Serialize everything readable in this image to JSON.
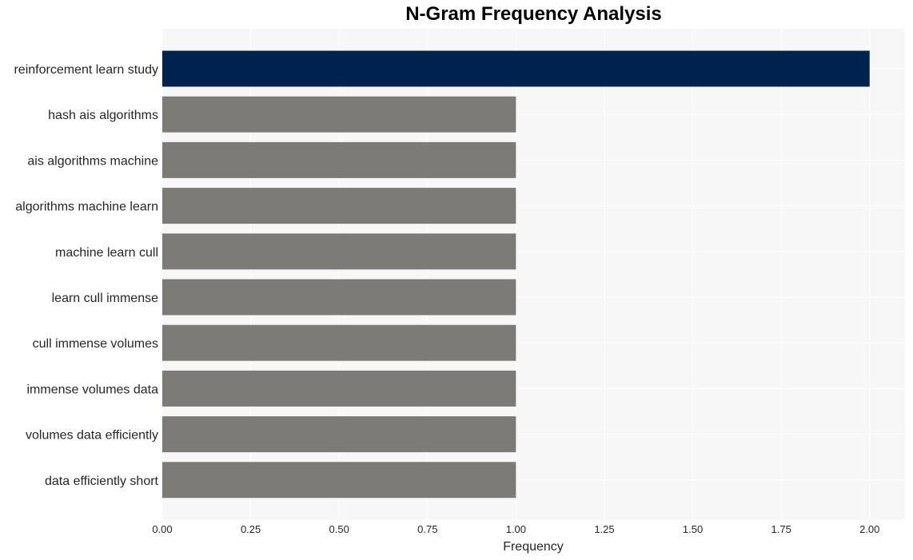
{
  "chart_data": {
    "type": "bar",
    "orientation": "horizontal",
    "title": "N-Gram Frequency Analysis",
    "xlabel": "Frequency",
    "ylabel": "",
    "categories": [
      "reinforcement learn study",
      "hash ais algorithms",
      "ais algorithms machine",
      "algorithms machine learn",
      "machine learn cull",
      "learn cull immense",
      "cull immense volumes",
      "immense volumes data",
      "volumes data efficiently",
      "data efficiently short"
    ],
    "values": [
      2,
      1,
      1,
      1,
      1,
      1,
      1,
      1,
      1,
      1
    ],
    "bar_colors": [
      "#00224e",
      "#7c7b77",
      "#7c7b77",
      "#7c7b77",
      "#7c7b77",
      "#7c7b77",
      "#7c7b77",
      "#7c7b77",
      "#7c7b77",
      "#7c7b77"
    ],
    "xlim": [
      0,
      2.1
    ],
    "xticks": [
      "0.00",
      "0.25",
      "0.50",
      "0.75",
      "1.00",
      "1.25",
      "1.50",
      "1.75",
      "2.00"
    ],
    "xtick_values": [
      0,
      0.25,
      0.5,
      0.75,
      1.0,
      1.25,
      1.5,
      1.75,
      2.0
    ],
    "grid": true,
    "background": "#f7f7f7"
  }
}
